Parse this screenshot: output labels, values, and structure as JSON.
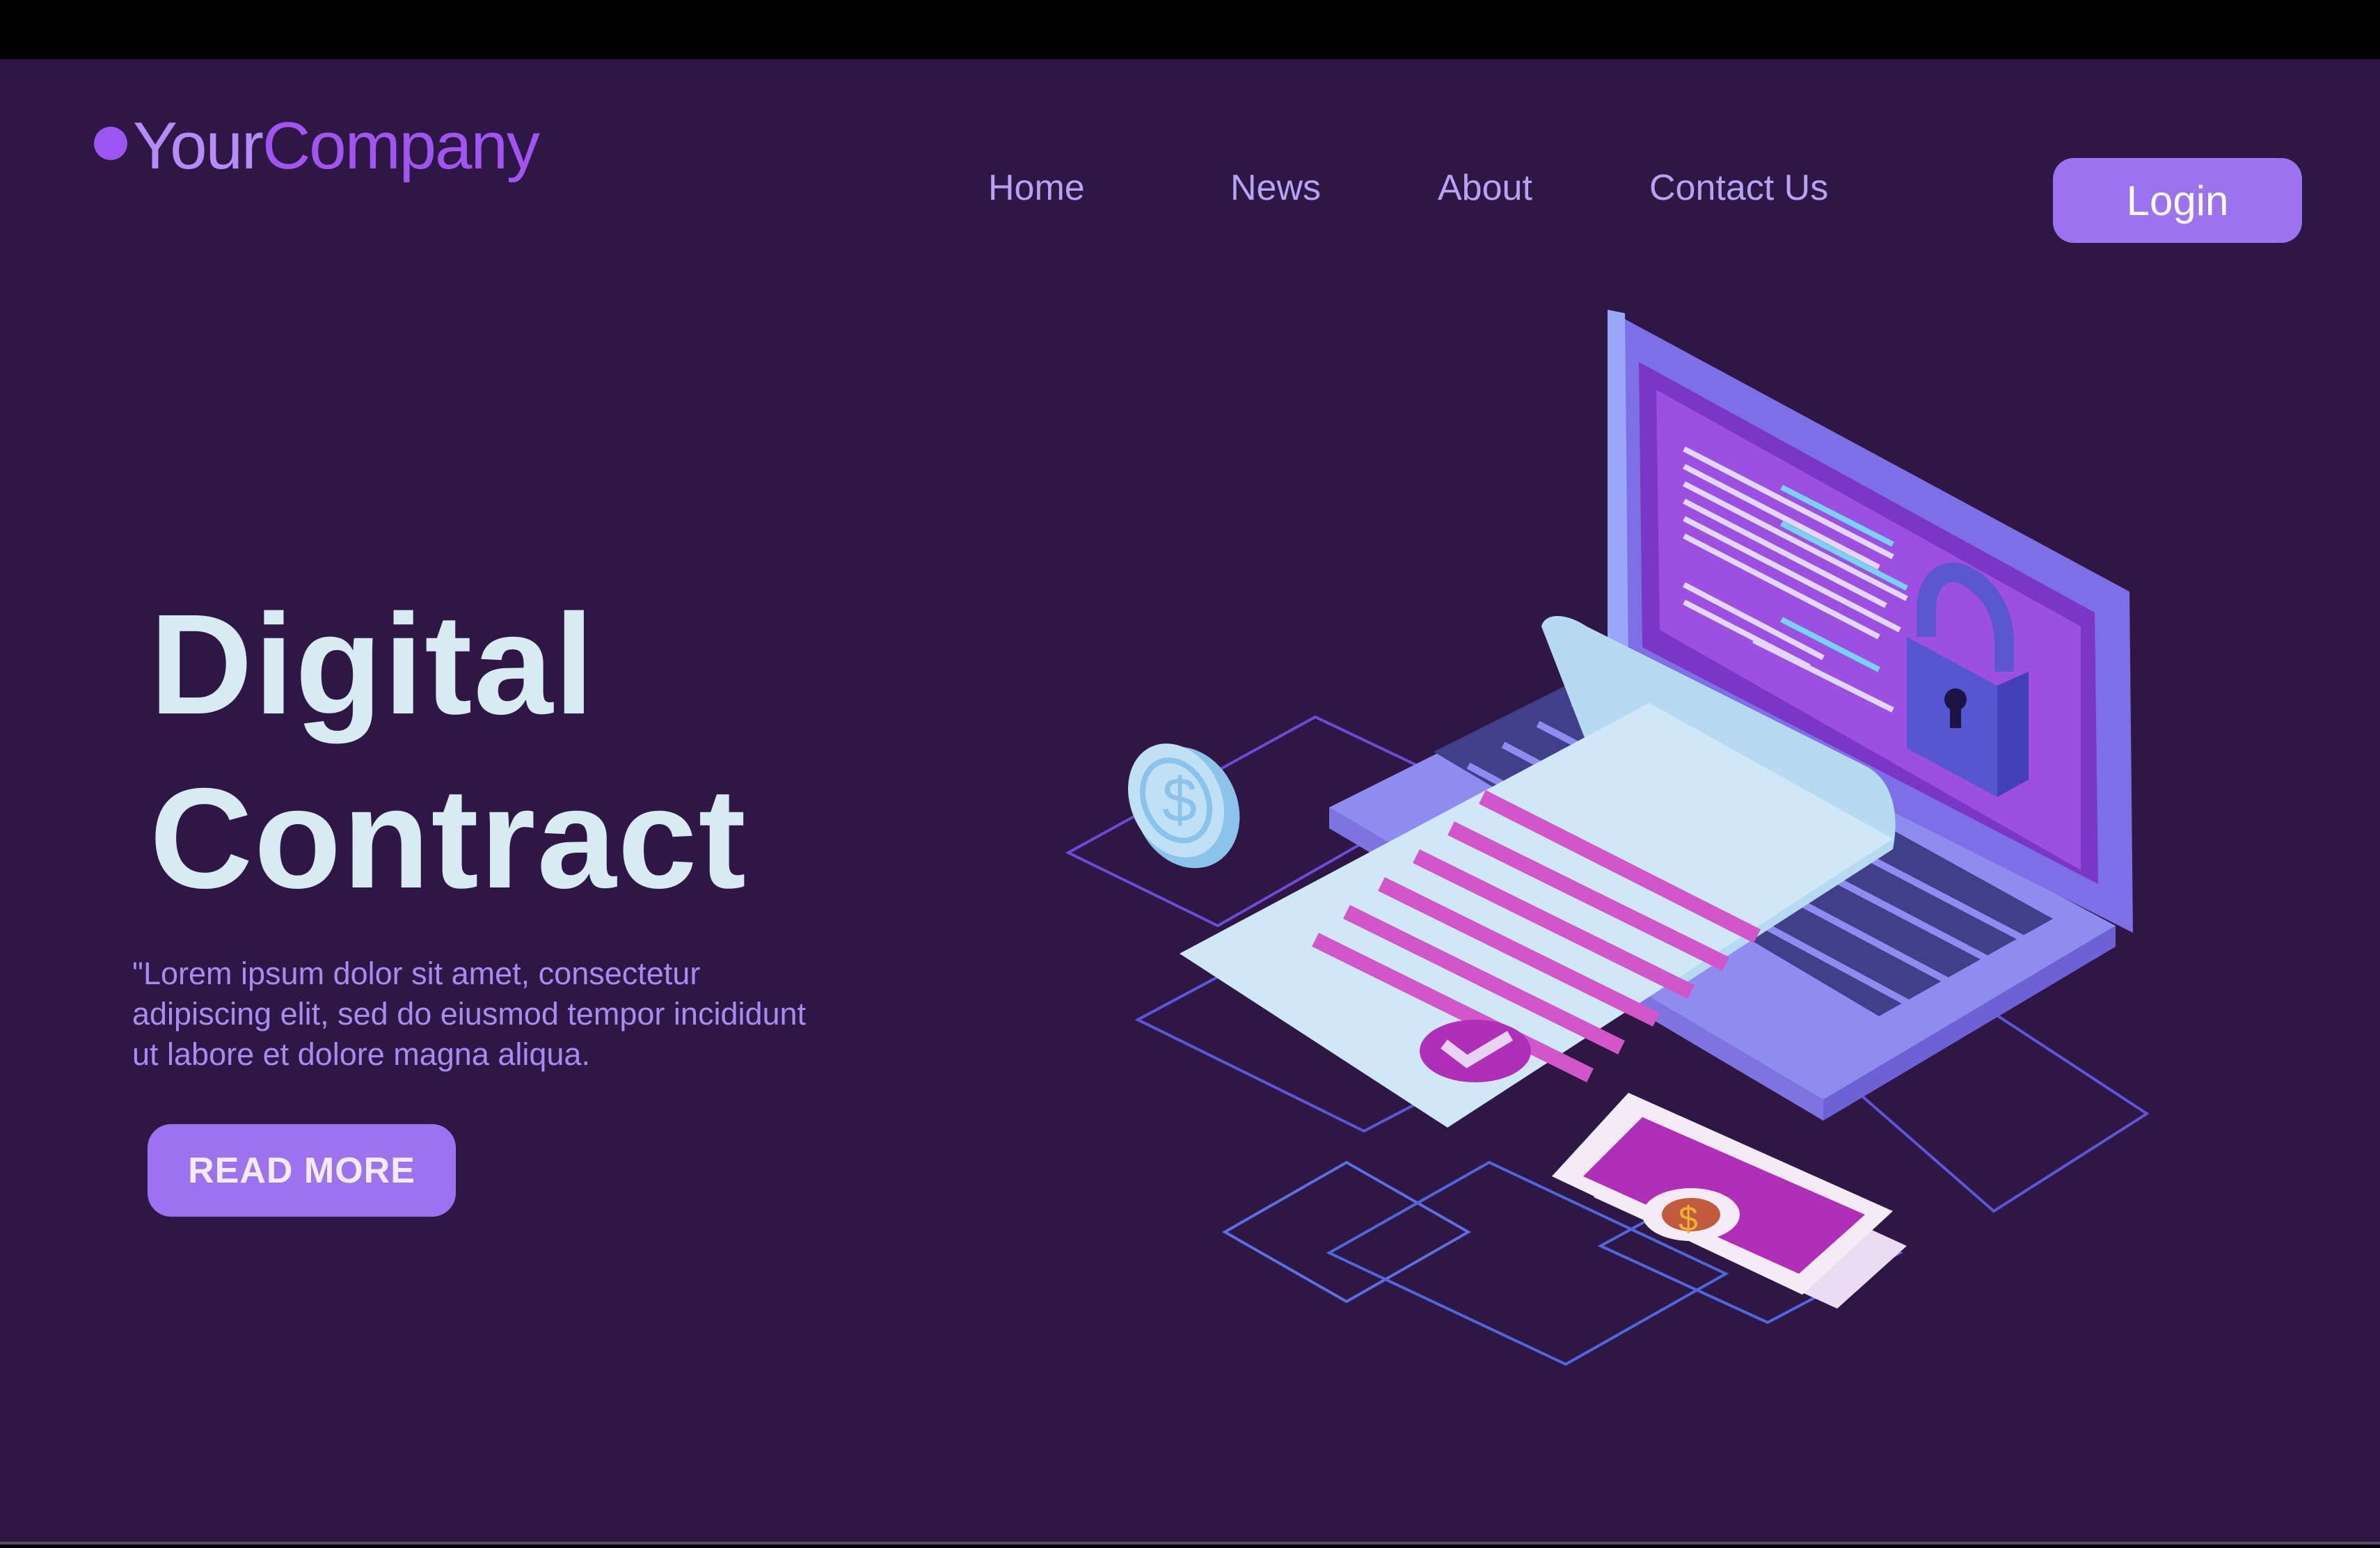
{
  "header": {
    "logo_your": "Your",
    "logo_company": "Company",
    "nav": [
      "Home",
      "News",
      "About",
      "Contact Us"
    ],
    "login_label": "Login"
  },
  "hero": {
    "title_line1": "Digital",
    "title_line2": "Contract",
    "description": "\"Lorem ipsum dolor sit amet, consectetur adipiscing elit, sed do eiusmod tempor incididunt ut labore et dolore magna aliqua.",
    "read_more_label": "READ MORE"
  },
  "illustration": {
    "icons": [
      "laptop-icon",
      "padlock-icon",
      "contract-document-icon",
      "checkmark-seal-icon",
      "dollar-coin-icon",
      "banknote-icon"
    ]
  },
  "colors": {
    "background": "#2e1744",
    "accent": "#9c72f0",
    "logo_company": "#a155f0",
    "nav_text": "#b6a3f2",
    "title_text": "#d8eaf2",
    "description_text": "#a78bf0"
  }
}
